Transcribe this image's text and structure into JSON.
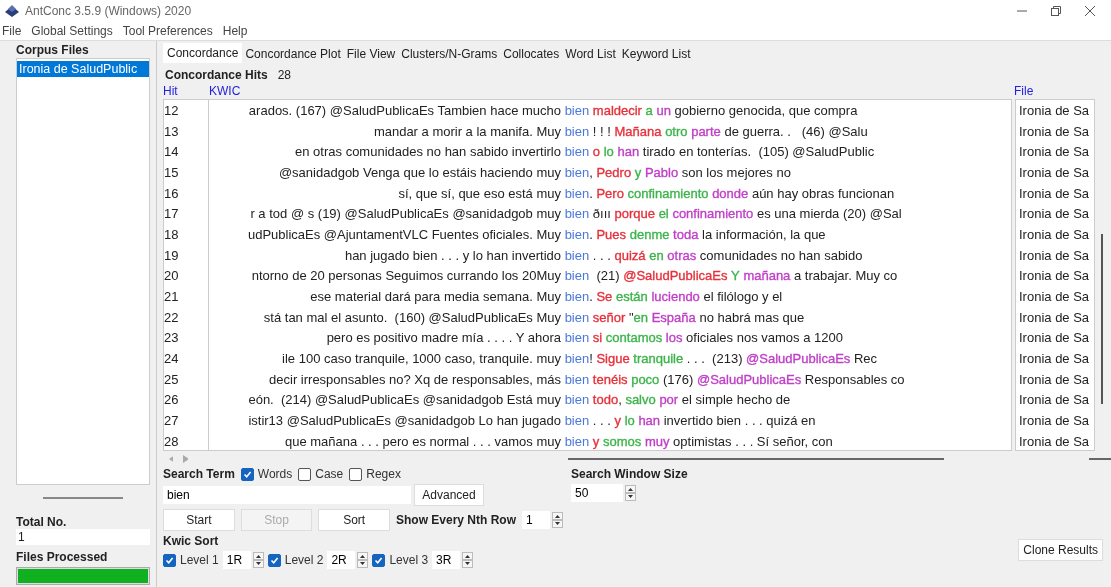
{
  "window": {
    "title": "AntConc 3.5.9 (Windows) 2020"
  },
  "menu": [
    "File",
    "Global Settings",
    "Tool Preferences",
    "Help"
  ],
  "sidebar": {
    "title": "Corpus Files",
    "files": [
      {
        "name": "Ironia de SaludPublic",
        "selected": true
      }
    ],
    "total_label": "Total No.",
    "total": "1",
    "processed_label": "Files Processed",
    "progress": {
      "level": 1
    }
  },
  "tabs": [
    {
      "label": "Concordance",
      "selected": true
    },
    {
      "label": "Concordance Plot",
      "selected": false
    },
    {
      "label": "File View",
      "selected": false
    },
    {
      "label": "Clusters/N-Grams",
      "selected": false
    },
    {
      "label": "Collocates",
      "selected": false
    },
    {
      "label": "Word List",
      "selected": false
    },
    {
      "label": "Keyword List",
      "selected": false
    }
  ],
  "hits": {
    "label": "Concordance Hits",
    "count": "28"
  },
  "table": {
    "columns": [
      "Hit",
      "KWIC",
      "File"
    ],
    "rows": [
      {
        "hit": "12",
        "left": "arados. (167) @SaludPublicaEs Tambien hace mucho",
        "node": "bien",
        "right": [
          {
            "text": "maldecir",
            "color": "#e6323c"
          },
          {
            "text": "a",
            "color": "#3cb44b"
          },
          {
            "text": "un",
            "color": "#c040c8"
          },
          {
            "text": "gobierno genocida, que compra"
          }
        ],
        "file": "Ironia de Sa"
      },
      {
        "hit": "13",
        "left": "mandar a morir a la manifa. Muy",
        "node": "bien",
        "right": [
          {
            "text": "! ! !"
          },
          {
            "text": "Mañana",
            "color": "#e6323c"
          },
          {
            "text": "otro",
            "color": "#3cb44b"
          },
          {
            "text": "parte",
            "color": "#c040c8"
          },
          {
            "text": "de guerra. .   (46) @Salu"
          }
        ],
        "file": "Ironia de Sa"
      },
      {
        "hit": "14",
        "left": "en otras comunidades no han sabido invertirlo",
        "node": "bien",
        "right": [
          {
            "text": "o",
            "color": "#e6323c"
          },
          {
            "text": "lo",
            "color": "#3cb44b"
          },
          {
            "text": "han",
            "color": "#c040c8"
          },
          {
            "text": "tirado en tonterías.  (105) @SaludPublic"
          }
        ],
        "file": "Ironia de Sa"
      },
      {
        "hit": "15",
        "left": "@sanidadgob Venga que lo estáis haciendo muy",
        "node": "bien",
        "right": [
          {
            "text": ",",
            "attach": true
          },
          {
            "text": "Pedro",
            "color": "#e6323c"
          },
          {
            "text": "y",
            "color": "#3cb44b"
          },
          {
            "text": "Pablo",
            "color": "#c040c8"
          },
          {
            "text": "son los mejores no"
          }
        ],
        "file": "Ironia de Sa"
      },
      {
        "hit": "16",
        "left": "sí, que sí, que eso está muy",
        "node": "bien",
        "right": [
          {
            "text": ".",
            "attach": true
          },
          {
            "text": "Pero",
            "color": "#e6323c"
          },
          {
            "text": "confinamiento",
            "color": "#3cb44b"
          },
          {
            "text": "donde",
            "color": "#c040c8"
          },
          {
            "text": "aún hay obras funcionan"
          }
        ],
        "file": "Ironia de Sa"
      },
      {
        "hit": "17",
        "left": "r a tod @ s (19) @SaludPublicaEs @sanidadgob muy",
        "node": "bien",
        "right": [
          {
            "text": "ðııı"
          },
          {
            "text": "porque",
            "color": "#e6323c"
          },
          {
            "text": "el",
            "color": "#3cb44b"
          },
          {
            "text": "confinamiento",
            "color": "#c040c8"
          },
          {
            "text": "es una mierda (20) @Sal"
          }
        ],
        "file": "Ironia de Sa"
      },
      {
        "hit": "18",
        "left": "udPublicaEs @AjuntamentVLC Fuentes oficiales. Muy",
        "node": "bien",
        "right": [
          {
            "text": ".",
            "attach": true
          },
          {
            "text": "Pues",
            "color": "#e6323c"
          },
          {
            "text": "denme",
            "color": "#3cb44b"
          },
          {
            "text": "toda",
            "color": "#c040c8"
          },
          {
            "text": "la información, la que"
          }
        ],
        "file": "Ironia de Sa"
      },
      {
        "hit": "19",
        "left": "han jugado bien . . . y lo han invertido",
        "node": "bien",
        "right": [
          {
            "text": ". . ."
          },
          {
            "text": "quizá",
            "color": "#e6323c"
          },
          {
            "text": "en",
            "color": "#3cb44b"
          },
          {
            "text": "otras",
            "color": "#c040c8"
          },
          {
            "text": "comunidades no han sabido"
          }
        ],
        "file": "Ironia de Sa"
      },
      {
        "hit": "20",
        "left": "ntorno de 20 personas Seguimos currando los 20Muy",
        "node": "bien",
        "right": [
          {
            "text": " (21)"
          },
          {
            "text": "@SaludPublicaEs",
            "color": "#e6323c"
          },
          {
            "text": "Y",
            "color": "#3cb44b"
          },
          {
            "text": "mañana",
            "color": "#c040c8"
          },
          {
            "text": "a trabajar. Muy co"
          }
        ],
        "file": "Ironia de Sa"
      },
      {
        "hit": "21",
        "left": "ese material dará para media semana. Muy",
        "node": "bien",
        "right": [
          {
            "text": ".",
            "attach": true
          },
          {
            "text": "Se",
            "color": "#e6323c"
          },
          {
            "text": "están",
            "color": "#3cb44b"
          },
          {
            "text": "luciendo",
            "color": "#c040c8"
          },
          {
            "text": "el filólogo y el"
          }
        ],
        "file": "Ironia de Sa"
      },
      {
        "hit": "22",
        "left": "stá tan mal el asunto.  (160) @SaludPublicaEs Muy",
        "node": "bien",
        "right": [
          {
            "text": "señor",
            "color": "#e6323c"
          },
          {
            "text": "\""
          },
          {
            "text": "en",
            "color": "#3cb44b",
            "attach": true
          },
          {
            "text": "España",
            "color": "#c040c8"
          },
          {
            "text": "no habrá mas que"
          }
        ],
        "file": "Ironia de Sa"
      },
      {
        "hit": "23",
        "left": "pero es positivo madre mía . . . . Y ahora",
        "node": "bien",
        "right": [
          {
            "text": "si",
            "color": "#e6323c"
          },
          {
            "text": "contamos",
            "color": "#3cb44b"
          },
          {
            "text": "los",
            "color": "#c040c8"
          },
          {
            "text": "oficiales nos vamos a 1200"
          }
        ],
        "file": "Ironia de Sa"
      },
      {
        "hit": "24",
        "left": "ile 100 caso tranquile, 1000 caso, tranquile. muy",
        "node": "bien",
        "right": [
          {
            "text": "!",
            "attach": true
          },
          {
            "text": "Sigue",
            "color": "#e6323c"
          },
          {
            "text": "tranquile",
            "color": "#3cb44b"
          },
          {
            "text": ". . .  (213)"
          },
          {
            "text": "@SaludPublicaEs",
            "color": "#c040c8"
          },
          {
            "text": "Rec"
          }
        ],
        "file": "Ironia de Sa"
      },
      {
        "hit": "25",
        "left": "decir irresponsables no? Xq de responsables, más",
        "node": "bien",
        "right": [
          {
            "text": "tenéis",
            "color": "#e6323c"
          },
          {
            "text": "poco",
            "color": "#3cb44b"
          },
          {
            "text": "(176)"
          },
          {
            "text": "@SaludPublicaEs",
            "color": "#c040c8"
          },
          {
            "text": "Responsables co"
          }
        ],
        "file": "Ironia de Sa"
      },
      {
        "hit": "26",
        "left": "eón.  (214) @SaludPublicaEs @sanidadgob Está muy",
        "node": "bien",
        "right": [
          {
            "text": "todo",
            "color": "#e6323c"
          },
          {
            "text": ",",
            "attach": true
          },
          {
            "text": "salvo",
            "color": "#3cb44b"
          },
          {
            "text": "por",
            "color": "#c040c8"
          },
          {
            "text": "el simple hecho de"
          }
        ],
        "file": "Ironia de Sa"
      },
      {
        "hit": "27",
        "left": "istir13 @SaludPublicaEs @sanidadgob Lo han jugado",
        "node": "bien",
        "right": [
          {
            "text": ". . ."
          },
          {
            "text": "y",
            "color": "#e6323c"
          },
          {
            "text": "lo",
            "color": "#3cb44b"
          },
          {
            "text": "han",
            "color": "#c040c8"
          },
          {
            "text": "invertido bien . . . quizá en"
          }
        ],
        "file": "Ironia de Sa"
      },
      {
        "hit": "28",
        "left": "que mañana . . . pero es normal . . . vamos muy",
        "node": "bien",
        "right": [
          {
            "text": "y",
            "color": "#e6323c"
          },
          {
            "text": "somos",
            "color": "#3cb44b"
          },
          {
            "text": "muy",
            "color": "#c040c8"
          },
          {
            "text": "optimistas . . . Sí señor, con"
          }
        ],
        "file": "Ironia de Sa"
      }
    ]
  },
  "search": {
    "label": "Search Term",
    "options": [
      {
        "label": "Words",
        "checked": true
      },
      {
        "label": "Case",
        "checked": false
      },
      {
        "label": "Regex",
        "checked": false
      }
    ],
    "value": "bien",
    "advanced": "Advanced",
    "buttons": [
      {
        "label": "Start",
        "disabled": false
      },
      {
        "label": "Stop",
        "disabled": true
      },
      {
        "label": "Sort",
        "disabled": false
      }
    ],
    "nth_label": "Show Every Nth Row",
    "nth": "1",
    "window_label": "Search Window Size",
    "window_size": "50"
  },
  "kwic_sort": {
    "label": "Kwic Sort",
    "levels": [
      {
        "label": "Level 1",
        "checked": true,
        "value": "1R"
      },
      {
        "label": "Level 2",
        "checked": true,
        "value": "2R"
      },
      {
        "label": "Level 3",
        "checked": true,
        "value": "3R"
      }
    ]
  },
  "clone": "Clone Results"
}
